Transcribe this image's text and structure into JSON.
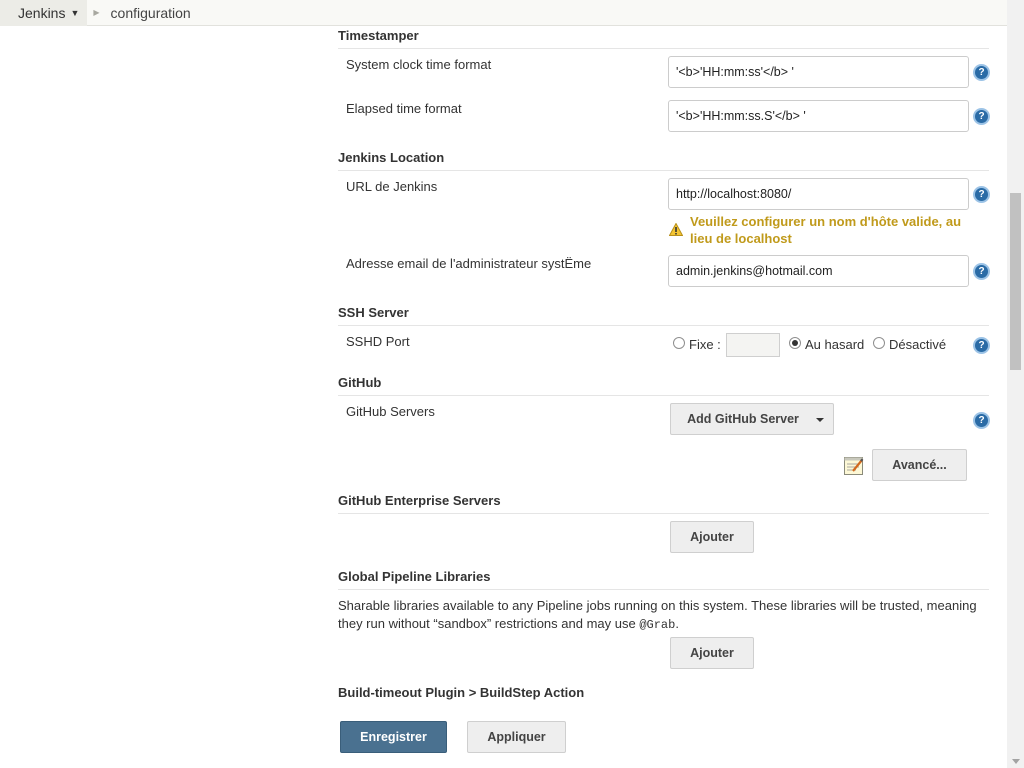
{
  "breadcrumb": {
    "root": "Jenkins",
    "current": "configuration"
  },
  "timestamper": {
    "title": "Timestamper",
    "system_clock_label": "System clock time format",
    "system_clock_value": "'<b>'HH:mm:ss'</b> '",
    "elapsed_label": "Elapsed time format",
    "elapsed_value": "'<b>'HH:mm:ss.S'</b> '"
  },
  "jenkins_location": {
    "title": "Jenkins Location",
    "url_label": "URL de Jenkins",
    "url_value": "http://localhost:8080/",
    "url_warning": "Veuillez configurer un nom d'hôte valide, au lieu de localhost",
    "email_label": "Adresse email de l'administrateur systËme",
    "email_value": "admin.jenkins@hotmail.com"
  },
  "ssh_server": {
    "title": "SSH Server",
    "port_label": "SSHD Port",
    "options": [
      "Fixe :",
      "Au hasard",
      "Désactivé"
    ],
    "selected": "Au hasard",
    "fixed_value": ""
  },
  "github": {
    "title": "GitHub",
    "servers_label": "GitHub Servers",
    "add_button": "Add GitHub Server",
    "advanced_button": "Avancé..."
  },
  "github_enterprise": {
    "title": "GitHub Enterprise Servers",
    "add_button": "Ajouter"
  },
  "pipeline_libraries": {
    "title": "Global Pipeline Libraries",
    "description_part1": "Sharable libraries available to any Pipeline jobs running on this system. These libraries will be trusted, meaning they run without “sandbox” restrictions and may use ",
    "description_code": "@Grab",
    "description_part2": ".",
    "add_button": "Ajouter"
  },
  "build_timeout": {
    "title": "Build-timeout Plugin > BuildStep Action"
  },
  "actions": {
    "save": "Enregistrer",
    "apply": "Appliquer"
  },
  "icons": {
    "help": "help-icon",
    "warning": "warning-icon",
    "notepad": "notepad-icon"
  },
  "colors": {
    "primary_button": "#4a7190",
    "warning_text": "#c09a1b",
    "help_icon": "#2a6ba6"
  }
}
